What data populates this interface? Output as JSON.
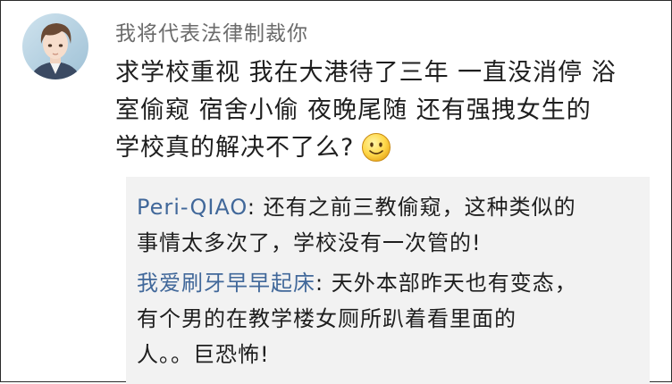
{
  "comment": {
    "username": "我将代表法律制裁你",
    "lines": [
      "求学校重视 我在大港待了三年 一直没消停 浴",
      "室偷窥 宿舍小偷 夜晚尾随 还有强拽女生的",
      "学校真的解决不了么?"
    ],
    "emoji": "smile-emoji"
  },
  "replies": [
    {
      "author": "Peri-QIAO",
      "separator": ": ",
      "lines": [
        "还有之前三教偷窥，这种类似的",
        "事情太多次了，学校没有一次管的!"
      ]
    },
    {
      "author": "我爱刷牙早早起床",
      "separator": ": ",
      "lines": [
        "天外本部昨天也有变态，",
        "有个男的在教学楼女厕所趴着看里面的",
        "人。。巨恐怖!"
      ]
    }
  ],
  "colors": {
    "author_link": "#41689a",
    "reply_background": "#f2f2f2",
    "username": "#6b6b6b",
    "text": "#1e1e1e"
  }
}
